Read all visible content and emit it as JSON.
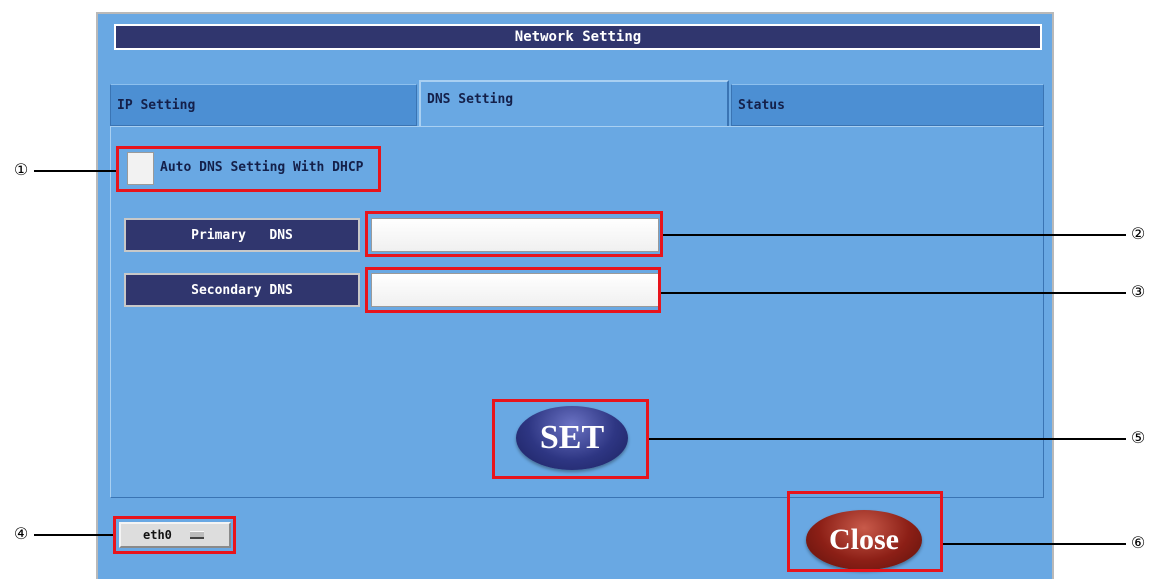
{
  "window": {
    "title": "Network Setting",
    "tabs": [
      {
        "label": "IP Setting",
        "active": false
      },
      {
        "label": "DNS Setting",
        "active": true
      },
      {
        "label": "Status",
        "active": false
      }
    ]
  },
  "dns_settings": {
    "auto_dns_label": "Auto DNS Setting With DHCP",
    "auto_dns_checked": false,
    "primary_label": "Primary   DNS",
    "primary_value": "",
    "secondary_label": "Secondary DNS",
    "secondary_value": "",
    "set_label": "SET"
  },
  "footer": {
    "interface_value": "eth0",
    "close_label": "Close"
  },
  "callouts": [
    "①",
    "②",
    "③",
    "④",
    "⑤",
    "⑥"
  ],
  "colors": {
    "panel_bg": "#69a8e3",
    "title_bar": "#30366e",
    "highlight": "#e8141c",
    "set_button": "#2e3683",
    "close_button": "#8c1f16"
  }
}
